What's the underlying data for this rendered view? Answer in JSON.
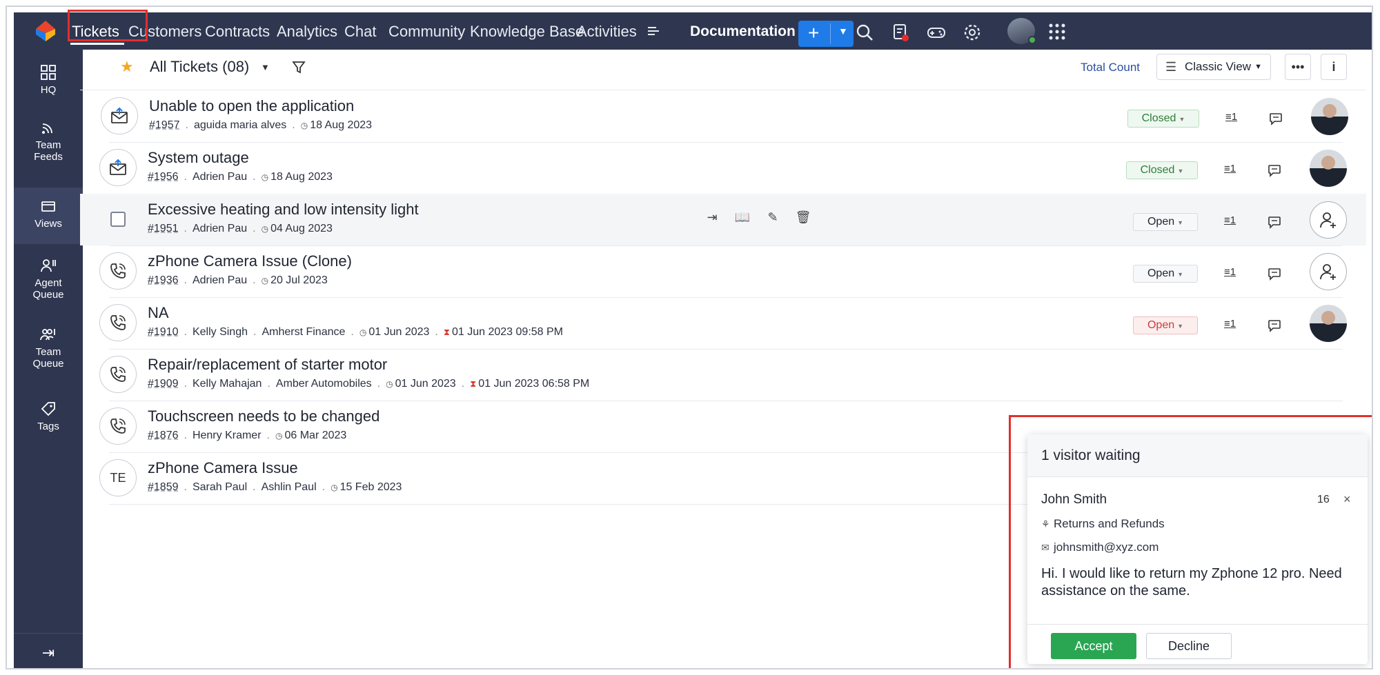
{
  "topnav": {
    "tabs": [
      "Tickets",
      "Customers",
      "Contracts",
      "Analytics",
      "Chat",
      "Community",
      "Knowledge Base",
      "Activities"
    ],
    "more_icon": "menu-lines-icon",
    "department": "Documentation",
    "new_button": "+"
  },
  "sidebar": {
    "items": [
      {
        "label": "HQ",
        "icon": "grid-icon"
      },
      {
        "label": "Team Feeds",
        "icon": "feed-icon"
      },
      {
        "label": "Views",
        "icon": "folder-icon"
      },
      {
        "label": "Agent Queue",
        "icon": "agent-icon"
      },
      {
        "label": "Team Queue",
        "icon": "team-icon"
      },
      {
        "label": "Tags",
        "icon": "tag-icon"
      }
    ],
    "collapse_icon": "⇥"
  },
  "toolbar": {
    "view_title": "All Tickets (08)",
    "total_count": "Total Count",
    "view_mode": "Classic View",
    "more": "•••",
    "info": "i"
  },
  "tickets": [
    {
      "subject": "Unable to open the application",
      "id": "#1957",
      "contact": "aguida maria alves",
      "account": "",
      "date": "18 Aug 2023",
      "due": "",
      "status": "Closed",
      "threads": "1",
      "channel": "email",
      "avatar": "photo"
    },
    {
      "subject": "System outage",
      "id": "#1956",
      "contact": "Adrien Pau",
      "account": "",
      "date": "18 Aug 2023",
      "due": "",
      "status": "Closed",
      "threads": "1",
      "channel": "email",
      "avatar": "photo"
    },
    {
      "subject": "Excessive heating and low intensity light",
      "id": "#1951",
      "contact": "Adrien Pau",
      "account": "",
      "date": "04 Aug 2023",
      "due": "",
      "status": "Open",
      "threads": "1",
      "channel": "checkbox",
      "avatar": "assign"
    },
    {
      "subject": "zPhone Camera Issue (Clone)",
      "id": "#1936",
      "contact": "Adrien Pau",
      "account": "",
      "date": "20 Jul 2023",
      "due": "",
      "status": "Open",
      "threads": "1",
      "channel": "phone",
      "avatar": "assign"
    },
    {
      "subject": "NA",
      "id": "#1910",
      "contact": "Kelly Singh",
      "account": "Amherst Finance",
      "date": "01 Jun 2023",
      "due": "01 Jun 2023 09:58 PM",
      "status": "Open",
      "threads": "1",
      "channel": "phone",
      "avatar": "photo"
    },
    {
      "subject": "Repair/replacement of starter motor",
      "id": "#1909",
      "contact": "Kelly Mahajan",
      "account": "Amber Automobiles",
      "date": "01 Jun 2023",
      "due": "01 Jun 2023 06:58 PM",
      "status": "",
      "threads": "",
      "channel": "phone",
      "avatar": ""
    },
    {
      "subject": "Touchscreen needs to be changed",
      "id": "#1876",
      "contact": "Henry Kramer",
      "account": "",
      "date": "06 Mar 2023",
      "due": "",
      "status": "",
      "threads": "",
      "channel": "phone",
      "avatar": ""
    },
    {
      "subject": "zPhone Camera Issue",
      "id": "#1859",
      "contact": "Sarah Paul",
      "account": "Ashlin Paul",
      "date": "15 Feb 2023",
      "due": "",
      "status": "",
      "threads": "",
      "channel": "TE",
      "avatar": ""
    }
  ],
  "chat_popup": {
    "header": "1 visitor waiting",
    "visitor_name": "John Smith",
    "count": "16",
    "close": "×",
    "department": "Returns and Refunds",
    "email": "johnsmith@xyz.com",
    "message": "Hi. I would like to return my Zphone 12 pro. Need assistance on the same.",
    "accept": "Accept",
    "decline": "Decline"
  },
  "colors": {
    "nav_bg": "#2f3650",
    "accent_blue": "#1f7be8",
    "accept_green": "#2aa653",
    "highlight_red": "#e0302c"
  }
}
